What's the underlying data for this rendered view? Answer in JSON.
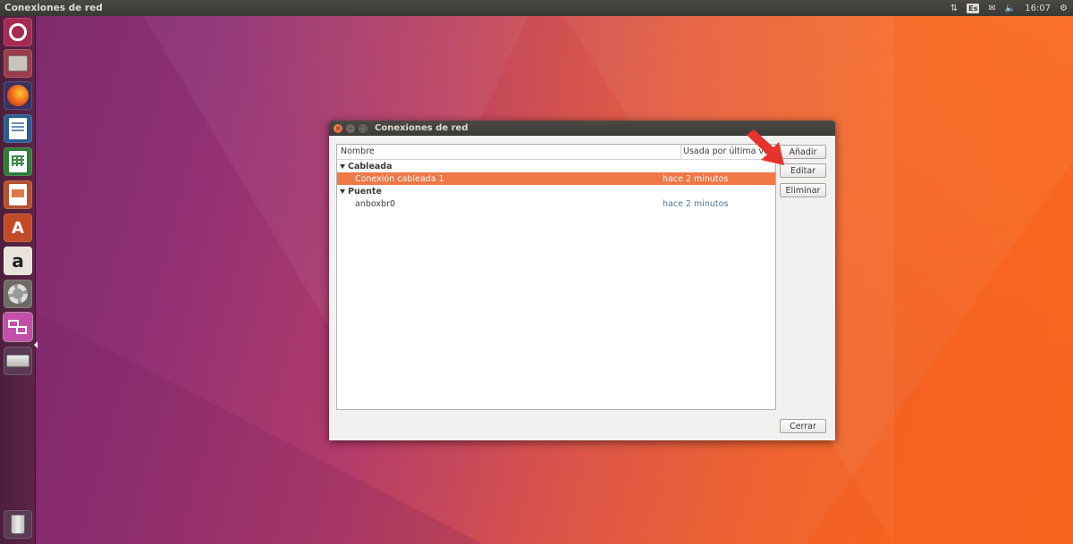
{
  "top_panel": {
    "app_title": "Conexiones de red",
    "keyboard_layout": "Es",
    "clock": "16:07"
  },
  "launcher": {
    "items": [
      "dash-icon",
      "files-icon",
      "firefox-icon",
      "writer-icon",
      "calc-icon",
      "impress-icon",
      "software-center-icon",
      "amazon-icon",
      "system-settings-icon",
      "remmina-icon",
      "disk-icon",
      "trash-icon"
    ],
    "software_glyph": "A",
    "amazon_glyph": "a"
  },
  "window": {
    "title": "Conexiones de red",
    "columns": {
      "name": "Nombre",
      "used": "Usada por última vez"
    },
    "groups": [
      {
        "label": "Cableada",
        "connections": [
          {
            "name": "Conexión cableada 1",
            "used": "hace 2 minutos",
            "selected": true
          }
        ]
      },
      {
        "label": "Puente",
        "connections": [
          {
            "name": "anboxbr0",
            "used": "hace 2 minutos",
            "selected": false
          }
        ]
      }
    ],
    "buttons": {
      "add": "Añadir",
      "edit": "Editar",
      "delete": "Eliminar",
      "close": "Cerrar"
    }
  },
  "colors": {
    "selection": "#f07746",
    "annotation_arrow": "#e8322d"
  }
}
